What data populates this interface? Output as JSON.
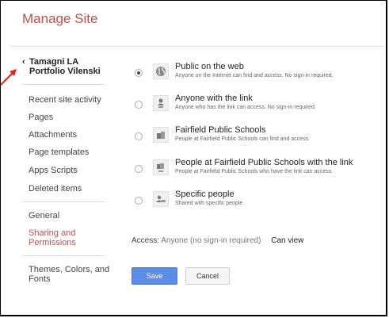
{
  "title": "Manage Site",
  "site_name_line1": "Tamagni LA",
  "site_name_line2": "Portfolio Vilenski",
  "back_icon": "chevron-left-icon",
  "nav_top": [
    "Recent site activity",
    "Pages",
    "Attachments",
    "Page templates",
    "Apps Scripts",
    "Deleted items"
  ],
  "nav_general": "General",
  "nav_sharing_line1": "Sharing and",
  "nav_sharing_line2": "Permissions",
  "nav_themes_line1": "Themes, Colors, and",
  "nav_themes_line2": "Fonts",
  "options": [
    {
      "title": "Public on the web",
      "desc": "Anyone on the Internet can find and access. No sign-in required.",
      "selected": true,
      "icon": "globe-icon"
    },
    {
      "title": "Anyone with the link",
      "desc": "Anyone who has the link can access. No sign-in required.",
      "selected": false,
      "icon": "person-link-icon"
    },
    {
      "title": "Fairfield Public Schools",
      "desc": "People at Fairfield Public Schools can find and access.",
      "selected": false,
      "icon": "building-icon"
    },
    {
      "title": "People at Fairfield Public Schools with the link",
      "desc": "People at Fairfield Public Schools who have the link can access.",
      "selected": false,
      "icon": "building-link-icon"
    },
    {
      "title": "Specific people",
      "desc": "Shared with specific people.",
      "selected": false,
      "icon": "people-icon"
    }
  ],
  "access_label": "Access:",
  "access_value": "Anyone (no sign-in required)",
  "access_permission": "Can view",
  "save_label": "Save",
  "cancel_label": "Cancel",
  "colors": {
    "accent": "#c0504d",
    "primary_button": "#5b8de6"
  }
}
